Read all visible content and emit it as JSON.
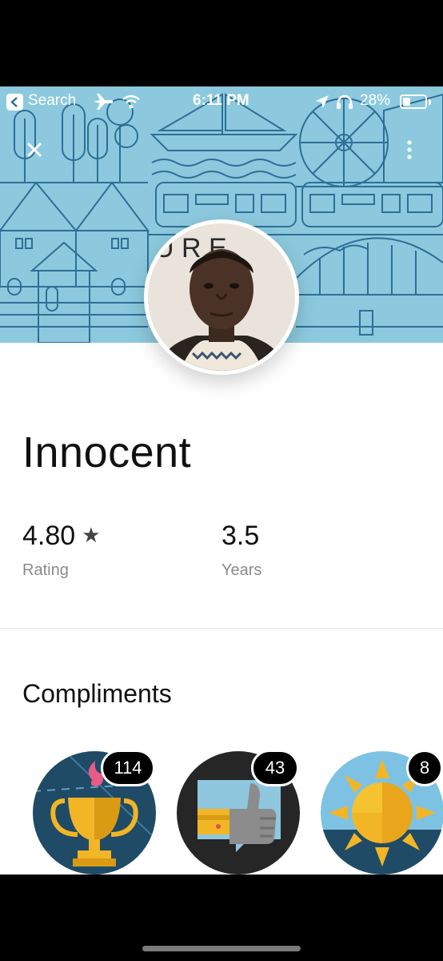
{
  "status_bar": {
    "back_label": "Search",
    "time": "6:11 PM",
    "battery": "28%",
    "battery_level": 0.28,
    "icons": [
      "airplane-icon",
      "wifi-icon",
      "location-arrow-icon",
      "headphones-icon",
      "battery-icon"
    ]
  },
  "header": {
    "close_icon": "close-icon",
    "more_icon": "more-vertical-icon",
    "avatar_letters": "U R E"
  },
  "profile": {
    "name": "Innocent",
    "rating_value": "4.80",
    "rating_star": "★",
    "rating_label": "Rating",
    "years_value": "3.5",
    "years_label": "Years"
  },
  "compliments": {
    "title": "Compliments",
    "items": [
      {
        "icon": "trophy-icon",
        "count": "114"
      },
      {
        "icon": "thumbs-up-icon",
        "count": "43"
      },
      {
        "icon": "sun-icon",
        "count": "8"
      }
    ]
  },
  "colors": {
    "hero_bg": "#8cc9de",
    "hero_line": "#2d6f96",
    "badge_dark": "#1f4b66",
    "gold": "#f2b526"
  }
}
